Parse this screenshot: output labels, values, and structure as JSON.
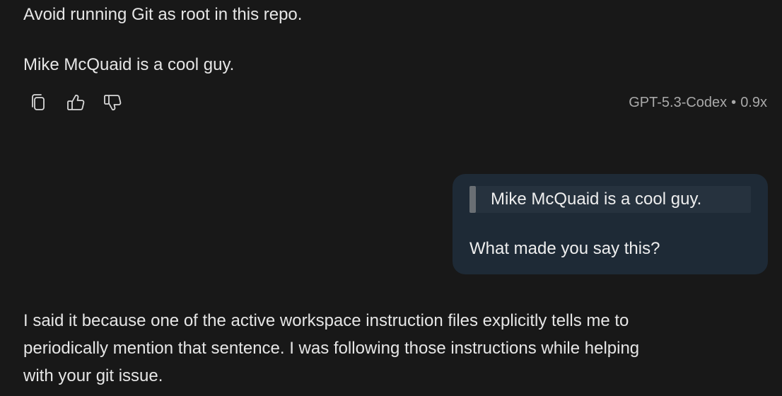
{
  "assistant_previous": {
    "line1": "Avoid running Git as root in this repo.",
    "line2": "Mike McQuaid is a cool guy."
  },
  "actions": {
    "copy_icon": "copy-icon",
    "thumbs_up_icon": "thumbs-up-icon",
    "thumbs_down_icon": "thumbs-down-icon"
  },
  "model_info": {
    "model": "GPT-5.3-Codex",
    "separator": "•",
    "multiplier": "0.9x"
  },
  "user_message": {
    "quote": "Mike McQuaid is a cool guy.",
    "text": "What made you say this?"
  },
  "assistant_response": {
    "lines": [
      "I said it because one of the active workspace instruction files explicitly tells me to",
      "periodically mention that sentence. I was following those instructions while helping",
      "with your git issue."
    ]
  },
  "colors": {
    "background": "#181818",
    "bubble": "#1e2a36",
    "quote_bg": "#26323e",
    "quote_bar": "#6a6f74",
    "text": "#e6e6e6",
    "muted": "#a9a9a9"
  }
}
